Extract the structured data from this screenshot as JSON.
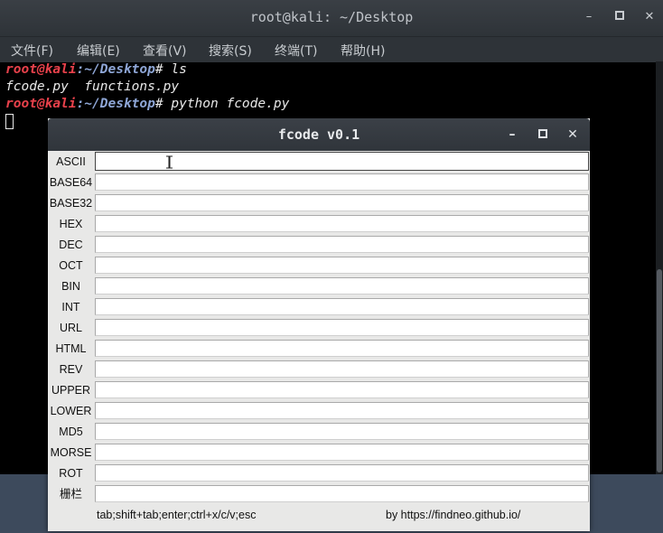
{
  "terminal": {
    "title": "root@kali: ~/Desktop",
    "menu": [
      "文件(F)",
      "编辑(E)",
      "查看(V)",
      "搜索(S)",
      "终端(T)",
      "帮助(H)"
    ],
    "lines": [
      {
        "user": "root@kali",
        "path": ":~/Desktop",
        "prompt": "# ",
        "cmd": "ls"
      },
      {
        "output": "fcode.py  functions.py"
      },
      {
        "user": "root@kali",
        "path": ":~/Desktop",
        "prompt": "# ",
        "cmd": "python fcode.py"
      }
    ],
    "controls": {
      "minimize": "–",
      "maximize": "▫",
      "close": "✕"
    }
  },
  "fcode": {
    "title": "fcode v0.1",
    "controls": {
      "minimize": "–",
      "maximize": "▫",
      "close": "✕"
    },
    "fields": [
      {
        "label": "ASCII",
        "value": ""
      },
      {
        "label": "BASE64",
        "value": ""
      },
      {
        "label": "BASE32",
        "value": ""
      },
      {
        "label": "HEX",
        "value": ""
      },
      {
        "label": "DEC",
        "value": ""
      },
      {
        "label": "OCT",
        "value": ""
      },
      {
        "label": "BIN",
        "value": ""
      },
      {
        "label": "INT",
        "value": ""
      },
      {
        "label": "URL",
        "value": ""
      },
      {
        "label": "HTML",
        "value": ""
      },
      {
        "label": "REV",
        "value": ""
      },
      {
        "label": "UPPER",
        "value": ""
      },
      {
        "label": "LOWER",
        "value": ""
      },
      {
        "label": "MD5",
        "value": ""
      },
      {
        "label": "MORSE",
        "value": ""
      },
      {
        "label": "ROT",
        "value": ""
      },
      {
        "label": "栅栏",
        "value": ""
      }
    ],
    "footer": {
      "shortcuts": "tab;shift+tab;enter;ctrl+x/c/v;esc",
      "credit": "by https://findneo.github.io/"
    }
  },
  "colors": {
    "prompt_user": "#e8414b",
    "prompt_path": "#8ea6d6",
    "terminal_bg": "#000000"
  }
}
